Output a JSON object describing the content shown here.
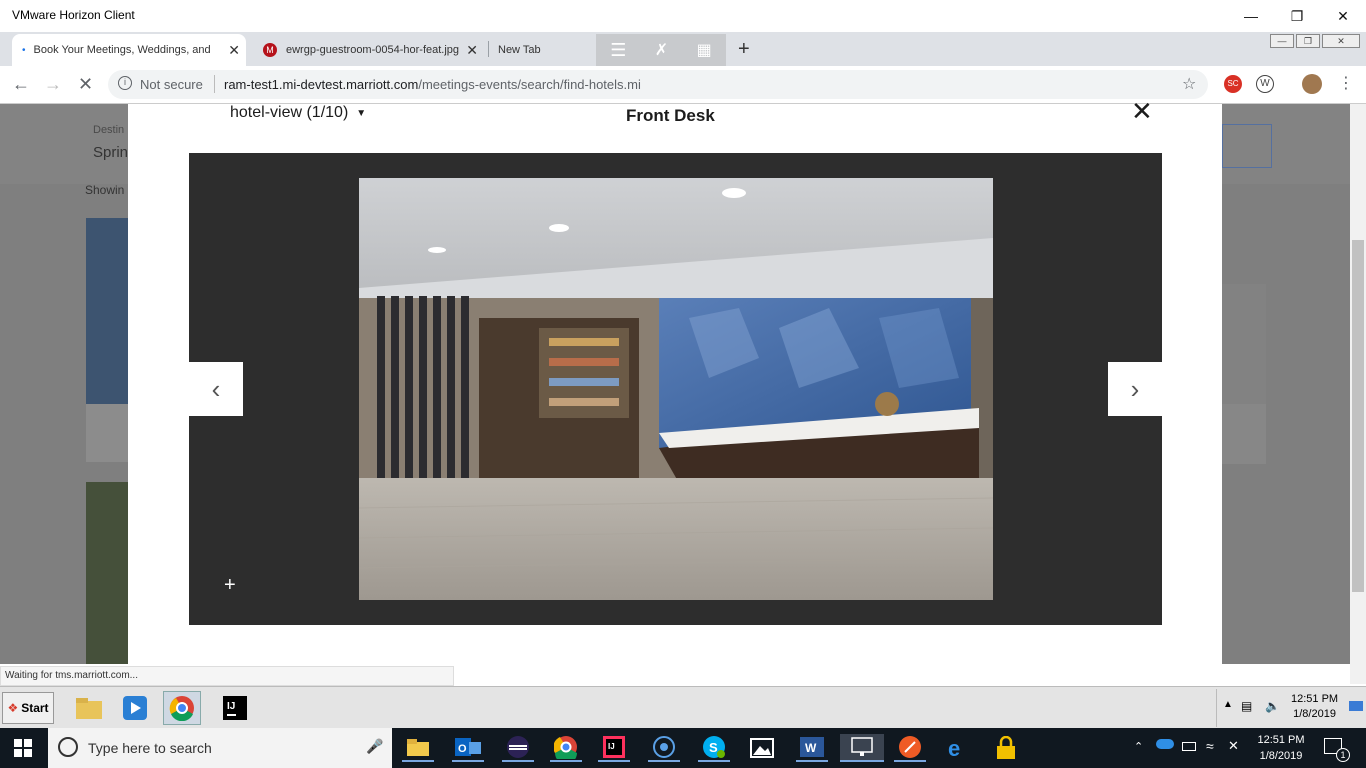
{
  "window": {
    "title": "VMware Horizon Client"
  },
  "tabs": [
    {
      "label": "Book Your Meetings, Weddings, and",
      "active": true
    },
    {
      "label": "ewrgp-guestroom-0054-hor-feat.jpg",
      "active": false
    },
    {
      "label": "New Tab",
      "active": false
    }
  ],
  "address": {
    "security": "Not secure",
    "domain": "ram-test1.mi-devtest.marriott.com",
    "path": "/meetings-events/search/find-hotels.mi"
  },
  "page_background": {
    "destination_label": "Destin",
    "destination_value": "Sprin",
    "showing_text": "Showin"
  },
  "modal": {
    "view_selector": "hotel-view (1/10)",
    "title": "Front Desk",
    "close_glyph": "✕",
    "prev_glyph": "‹",
    "next_glyph": "›",
    "zoom_glyph": "+"
  },
  "status_text": "Waiting for tms.marriott.com...",
  "inner_taskbar": {
    "start_label": "Start",
    "clock_time": "12:51 PM",
    "clock_date": "1/8/2019"
  },
  "taskbar": {
    "search_placeholder": "Type here to search",
    "clock_time": "12:51 PM",
    "clock_date": "1/8/2019",
    "notification_count": "1"
  },
  "colors": {
    "chrome_tabstrip": "#dee1e6",
    "modal_frame": "#2d2d2d",
    "overlay": "#7f7f7f",
    "taskbar": "#101820"
  }
}
